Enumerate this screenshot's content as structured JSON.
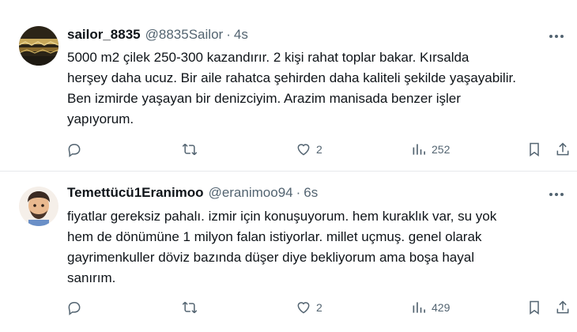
{
  "tweets": [
    {
      "name": "sailor_8835",
      "handle": "@8835Sailor",
      "separator": "·",
      "time": "4s",
      "text": "5000 m2 çilek 250-300 kazandırır. 2 kişi rahat toplar bakar. Kırsalda\nherşey daha ucuz. Bir aile rahatca şehirden daha kaliteli şekilde yaşayabilir.\nBen izmirde yaşayan bir denizciyim. Arazim manisada benzer işler\nyapıyorum.",
      "likes": "2",
      "views": "252"
    },
    {
      "name": "Temettücü1Eranimoo",
      "handle": "@eranimoo94",
      "separator": "·",
      "time": "6s",
      "text": "fiyatlar gereksiz pahalı. izmir için konuşuyorum. hem kuraklık var, su yok\nhem de dönümüne 1 milyon falan istiyorlar. millet uçmuş. genel olarak\ngayrimenkuller döviz bazında düşer diye bekliyorum ama boşa hayal\nsanırım.",
      "likes": "2",
      "views": "429"
    }
  ],
  "icons": {
    "reply": "reply-icon",
    "retweet": "retweet-icon",
    "like": "heart-icon",
    "views": "views-icon",
    "bookmark": "bookmark-icon",
    "share": "share-icon",
    "more": "more-icon"
  },
  "colors": {
    "text": "#0f1419",
    "secondary": "#536471",
    "divider": "#e6e9ec"
  }
}
